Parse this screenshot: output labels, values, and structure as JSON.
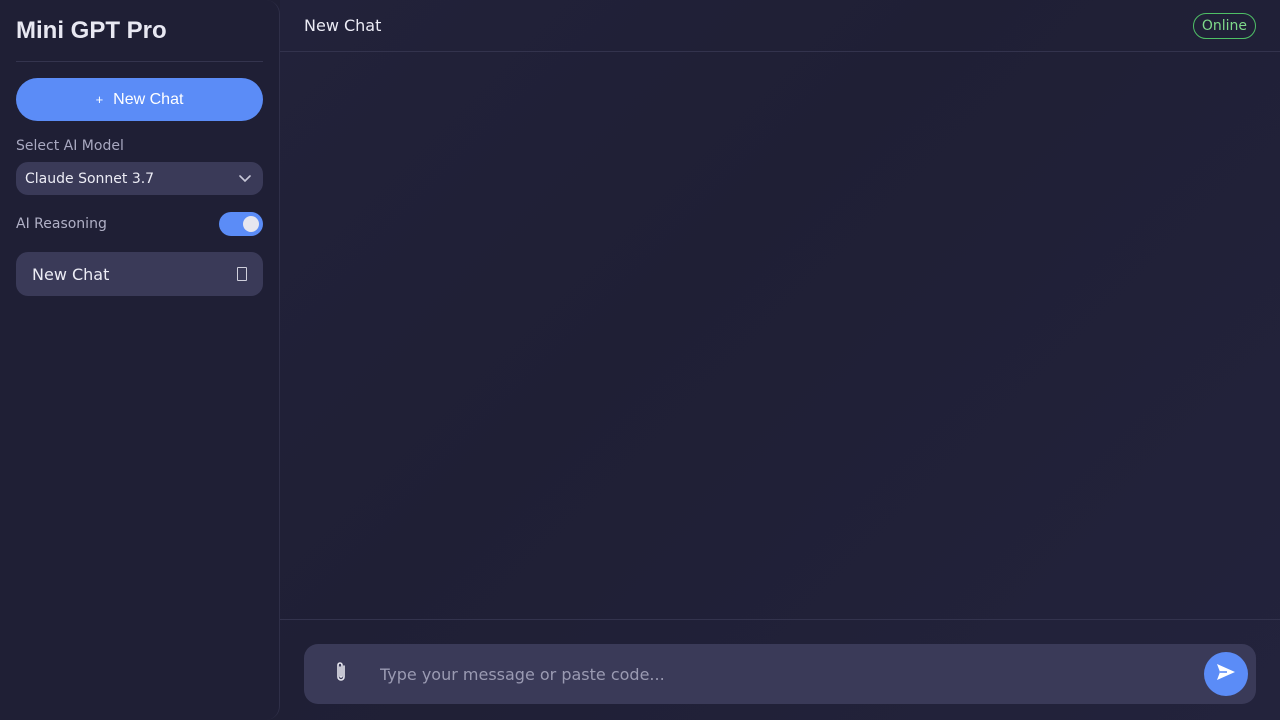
{
  "app": {
    "brand": "Mini GPT Pro"
  },
  "sidebar": {
    "new_chat_label": "New Chat",
    "new_chat_icon": "plus-icon",
    "model_label": "Select AI Model",
    "model_selected": "Claude Sonnet 3.7",
    "reasoning_label": "AI Reasoning",
    "reasoning_enabled": true,
    "chats": [
      {
        "title": "New Chat",
        "icon": "trash-icon"
      }
    ]
  },
  "header": {
    "title": "New Chat",
    "status": "Online"
  },
  "composer": {
    "placeholder": "Type your message or paste code...",
    "attach_icon": "paperclip-icon",
    "send_icon": "send-icon"
  },
  "colors": {
    "accent": "#5b8cf7",
    "status_online": "#7fd98a",
    "background": "#1f1f35",
    "surface": "#3a3a58"
  }
}
